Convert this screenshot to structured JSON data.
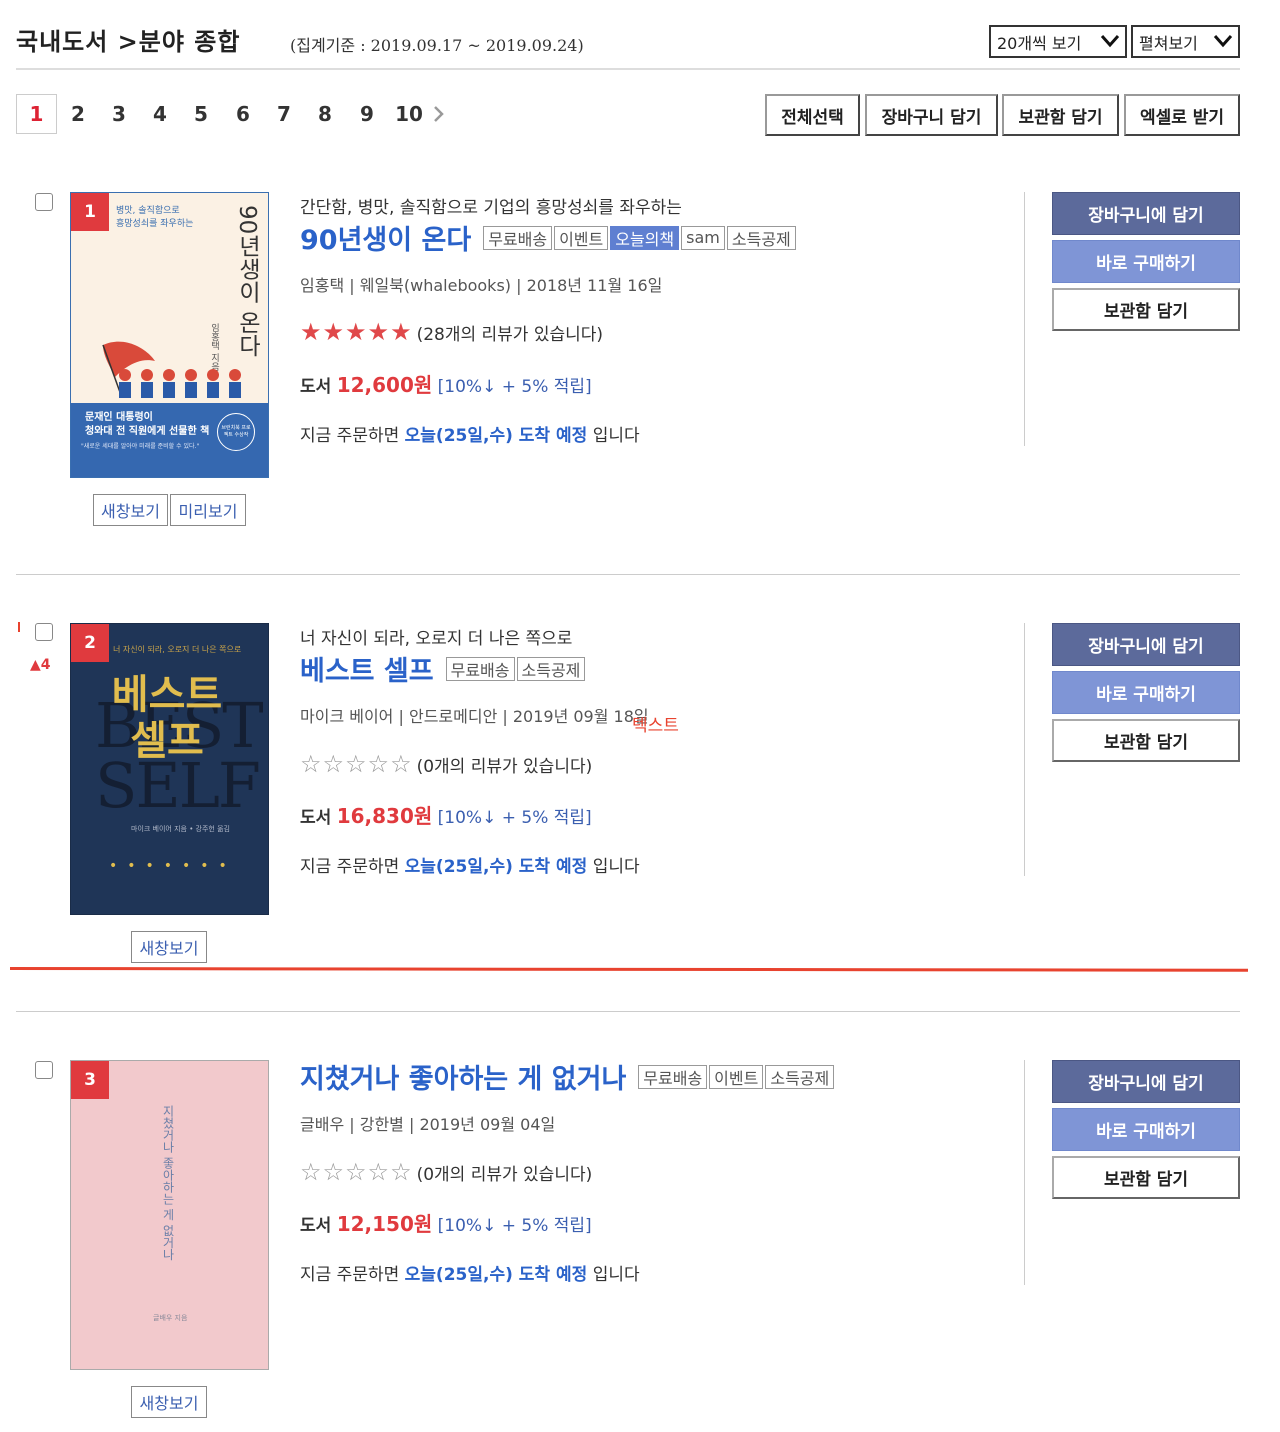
{
  "header": {
    "title": "국내도서 >분야 종합",
    "period": "(집계기준 : 2019.09.17 ~ 2019.09.24)",
    "per_page_select": "20개씩 보기",
    "view_select": "펼쳐보기"
  },
  "pagination": {
    "pages": [
      "1",
      "2",
      "3",
      "4",
      "5",
      "6",
      "7",
      "8",
      "9",
      "10"
    ],
    "current": "1"
  },
  "toolbar": {
    "select_all": "전체선택",
    "add_cart": "장바구니 담기",
    "add_keep": "보관함 담기",
    "excel": "엑셀로 받기"
  },
  "items": [
    {
      "rank": "1",
      "subtitle": "간단함, 병맛, 솔직함으로 기업의 흥망성쇠를 좌우하는",
      "title": "90년생이 온다",
      "tags": [
        "무료배송",
        "이벤트",
        "오늘의책",
        "sam",
        "소득공제"
      ],
      "meta": "임홍택 | 웨일북(whalebooks) | 2018년 11월 16일",
      "stars": "★★★★★",
      "reviews": "(28개의 리뷰가 있습니다)",
      "price_label": "도서",
      "price": "12,600원",
      "discount": "[10%↓ + 5% 적립]",
      "delivery_pre": "지금 주문하면",
      "delivery_hl": "오늘(25일,수) 도착 예정",
      "delivery_post": "입니다",
      "btn_newwin": "새창보기",
      "btn_preview": "미리보기",
      "cover": {
        "top_text1": "병맛, 솔직함으로",
        "top_text2": "흥망성쇠를 좌우하는",
        "vertical": "90년생이 온다",
        "author": "임홍택 지음",
        "band1": "문재인 대통령이",
        "band2": "청와대 전 직원에게 선물한 책",
        "band3": "\"새로운 세대를 알아야 미래를 준비할 수 있다.\"",
        "badge": "브런치북 프로젝트 수상작"
      }
    },
    {
      "rank": "2",
      "subtitle": "너 자신이 되라, 오로지 더 나은 쪽으로",
      "title": "베스트 셀프",
      "tags": [
        "무료배송",
        "소득공제"
      ],
      "meta": "마이크 베이어 | 안드로메디안 | 2019년 09월 18일",
      "stars": "☆☆☆☆☆",
      "reviews": "(0개의 리뷰가 있습니다)",
      "price_label": "도서",
      "price": "16,830원",
      "discount": "[10%↓ + 5% 적립]",
      "delivery_pre": "지금 주문하면",
      "delivery_hl": "오늘(25일,수) 도착 예정",
      "delivery_post": "입니다",
      "btn_newwin": "새창보기",
      "rank_change": "▲4",
      "overlay_text": "텍스트",
      "cover": {
        "top_text": "너 자신이 되라, 오로지 더 나은 쪽으로",
        "ko1": "베스트",
        "ko2": "셀프",
        "en1": "BEST",
        "en2": "SELF",
        "author": "마이크 베이어 지음 • 강주헌 옮김"
      }
    },
    {
      "rank": "3",
      "title": "지쳤거나 좋아하는 게 없거나",
      "tags": [
        "무료배송",
        "이벤트",
        "소득공제"
      ],
      "meta": "글배우 | 강한별 | 2019년 09월 04일",
      "stars": "☆☆☆☆☆",
      "reviews": "(0개의 리뷰가 있습니다)",
      "price_label": "도서",
      "price": "12,150원",
      "discount": "[10%↓ + 5% 적립]",
      "delivery_pre": "지금 주문하면",
      "delivery_hl": "오늘(25일,수) 도착 예정",
      "delivery_post": "입니다",
      "btn_newwin": "새창보기",
      "cover": {
        "vertical": "지쳤거나 좋아하는 게 없거나",
        "author": "글배우 지음"
      }
    }
  ],
  "actions": {
    "cart": "장바구니에 담기",
    "buy": "바로 구매하기",
    "keep": "보관함 담기"
  },
  "colors": {
    "accent_red": "#e03a3e",
    "link_blue": "#2a62c9",
    "cart_btn": "#5c6a9b",
    "buy_btn": "#7f95d6",
    "annotation_red": "#e8432f"
  }
}
